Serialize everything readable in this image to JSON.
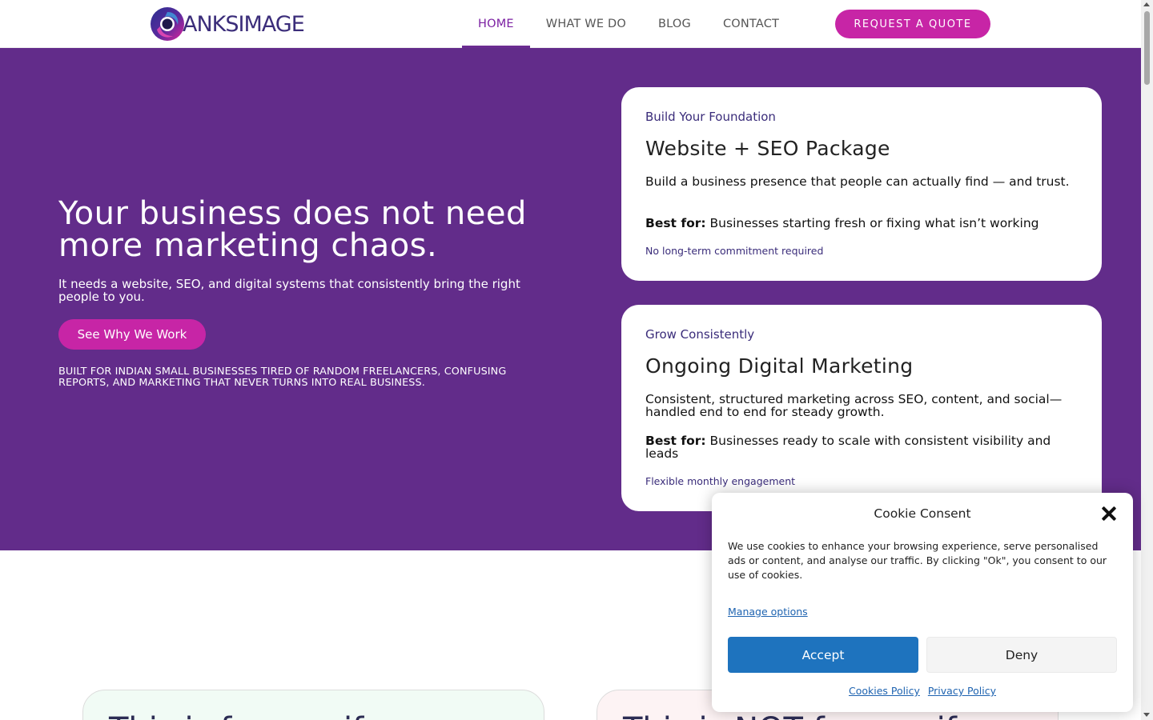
{
  "header": {
    "logo_text": "ANKSIMAGE",
    "nav": [
      {
        "label": "HOME",
        "active": true
      },
      {
        "label": "WHAT WE DO",
        "active": false
      },
      {
        "label": "BLOG",
        "active": false
      },
      {
        "label": "CONTACT",
        "active": false
      }
    ],
    "quote_button": "REQUEST A QUOTE"
  },
  "hero": {
    "title": "Your business does not need more marketing chaos.",
    "subtitle": "It needs a website, SEO, and digital systems that consistently bring the right people to you.",
    "cta": "See Why We Work",
    "note": "Built for Indian small businesses tired of random freelancers, confusing reports, and marketing that never turns into real business."
  },
  "cards": [
    {
      "eyebrow": "Build Your Foundation",
      "title": "Website + SEO Package",
      "description": "Build a business presence that people can actually find — and trust.",
      "best_label": "Best for:",
      "best_text": "Businesses starting fresh or fixing what isn’t working",
      "footnote": "No long-term commitment required"
    },
    {
      "eyebrow": "Grow Consistently",
      "title": "Ongoing Digital Marketing",
      "description": "Consistent, structured marketing across SEO, content, and social—handled end to end for steady growth.",
      "best_label": "Best for:",
      "best_text": "Businesses ready to scale with consistent visibility and leads",
      "footnote": "Flexible monthly engagement"
    }
  ],
  "lower": {
    "left_title": "This is for you if...",
    "right_title": "This is NOT for you if..."
  },
  "cookie": {
    "title": "Cookie Consent",
    "text": "We use cookies to enhance your browsing experience, serve personalised ads or content, and analyse our traffic. By clicking \"Ok\", you consent to our use of cookies.",
    "manage": "Manage options",
    "accept": "Accept",
    "deny": "Deny",
    "cookies_policy": "Cookies Policy",
    "privacy_policy": "Privacy Policy"
  },
  "colors": {
    "brand_purple": "#622c8a",
    "accent_magenta": "#c725a6",
    "accept_blue": "#1e73be"
  }
}
